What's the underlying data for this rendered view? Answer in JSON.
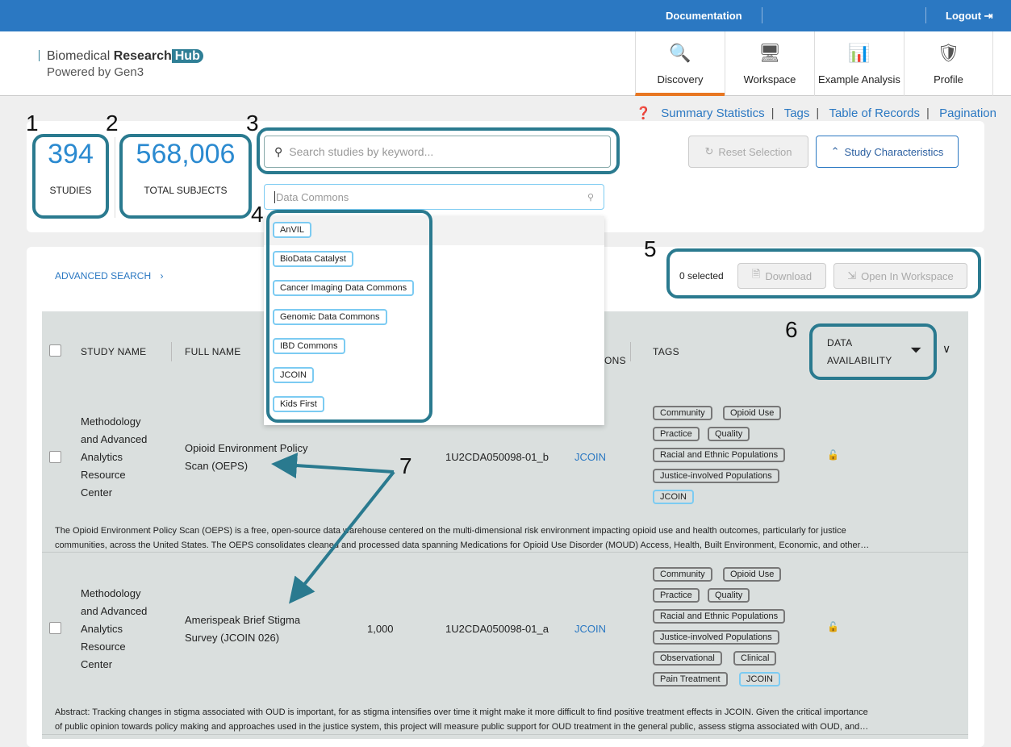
{
  "topbar": {
    "documentation": "Documentation",
    "logout": "Logout"
  },
  "logo": {
    "part1": "Biomedical ",
    "part2": "Research",
    "part3": "Hub",
    "powered": "Powered by Gen3"
  },
  "nav": [
    {
      "label": "Discovery",
      "icon": "discovery-icon"
    },
    {
      "label": "Workspace",
      "icon": "workspace-icon"
    },
    {
      "label": "Example Analysis",
      "icon": "chart-icon"
    },
    {
      "label": "Profile",
      "icon": "profile-shield-icon"
    }
  ],
  "help_links": [
    "Summary Statistics",
    "Tags",
    "Table of Records",
    "Pagination"
  ],
  "stats": {
    "studies_value": "394",
    "studies_label": "STUDIES",
    "subjects_value": "568,006",
    "subjects_label": "TOTAL SUBJECTS"
  },
  "search": {
    "placeholder": "Search studies by keyword..."
  },
  "data_commons": {
    "placeholder": "Data Commons",
    "options": [
      "AnVIL",
      "BioData Catalyst",
      "Cancer Imaging Data Commons",
      "Genomic Data Commons",
      "IBD Commons",
      "JCOIN",
      "Kids First"
    ]
  },
  "buttons": {
    "reset": "Reset Selection",
    "characteristics": "Study Characteristics",
    "advanced": "ADVANCED SEARCH",
    "selected": "0 selected",
    "download": "Download",
    "open_workspace": "Open In Workspace"
  },
  "annotations": [
    "1",
    "2",
    "3",
    "4",
    "5",
    "6",
    "7"
  ],
  "table": {
    "headers": [
      "STUDY NAME",
      "FULL NAME",
      "ONS",
      "TAGS",
      "DATA",
      "AVAILABILITY"
    ],
    "rows": [
      {
        "study_name": [
          "Methodology",
          "and Advanced",
          "Analytics",
          "Resource",
          "Center"
        ],
        "full_name": [
          "Opioid Environment Policy",
          "Scan (OEPS)"
        ],
        "subjects": "",
        "id": "1U2CDA050098-01_b",
        "commons": "JCOIN",
        "tags": [
          "Community",
          "Opioid Use",
          "Practice",
          "Quality",
          "Racial and Ethnic Populations",
          "Justice-involved Populations",
          "JCOIN"
        ],
        "desc": [
          "The Opioid Environment Policy Scan (OEPS) is a free, open-source data warehouse centered on the multi-dimensional risk environment impacting opioid use and health outcomes, particularly for justice",
          "communities, across the United States. The OEPS consolidates cleaned and processed data spanning Medications for Opioid Use Disorder (MOUD) Access, Health, Built Environment, Economic, and other…"
        ]
      },
      {
        "study_name": [
          "Methodology",
          "and Advanced",
          "Analytics",
          "Resource",
          "Center"
        ],
        "full_name": [
          "Amerispeak Brief Stigma",
          "Survey (JCOIN 026)"
        ],
        "subjects": "1,000",
        "id": "1U2CDA050098-01_a",
        "commons": "JCOIN",
        "tags": [
          "Community",
          "Opioid Use",
          "Practice",
          "Quality",
          "Racial and Ethnic Populations",
          "Justice-involved Populations",
          "Observational",
          "Clinical",
          "Pain Treatment",
          "JCOIN"
        ],
        "desc": [
          "Abstract: Tracking changes in stigma associated with OUD is important, for as stigma intensifies over time it might make it more difficult to find positive treatment effects in JCOIN. Given the critical importance",
          "of public opinion towards policy making and approaches used in the justice system, this project will measure public support for OUD treatment in the general public, assess stigma associated with OUD, and…"
        ]
      }
    ]
  },
  "colors": {
    "topbar": "#2b78c2",
    "accent": "#2b8ad0",
    "annotation": "#2a7a8f",
    "active_tab": "#e87722"
  }
}
